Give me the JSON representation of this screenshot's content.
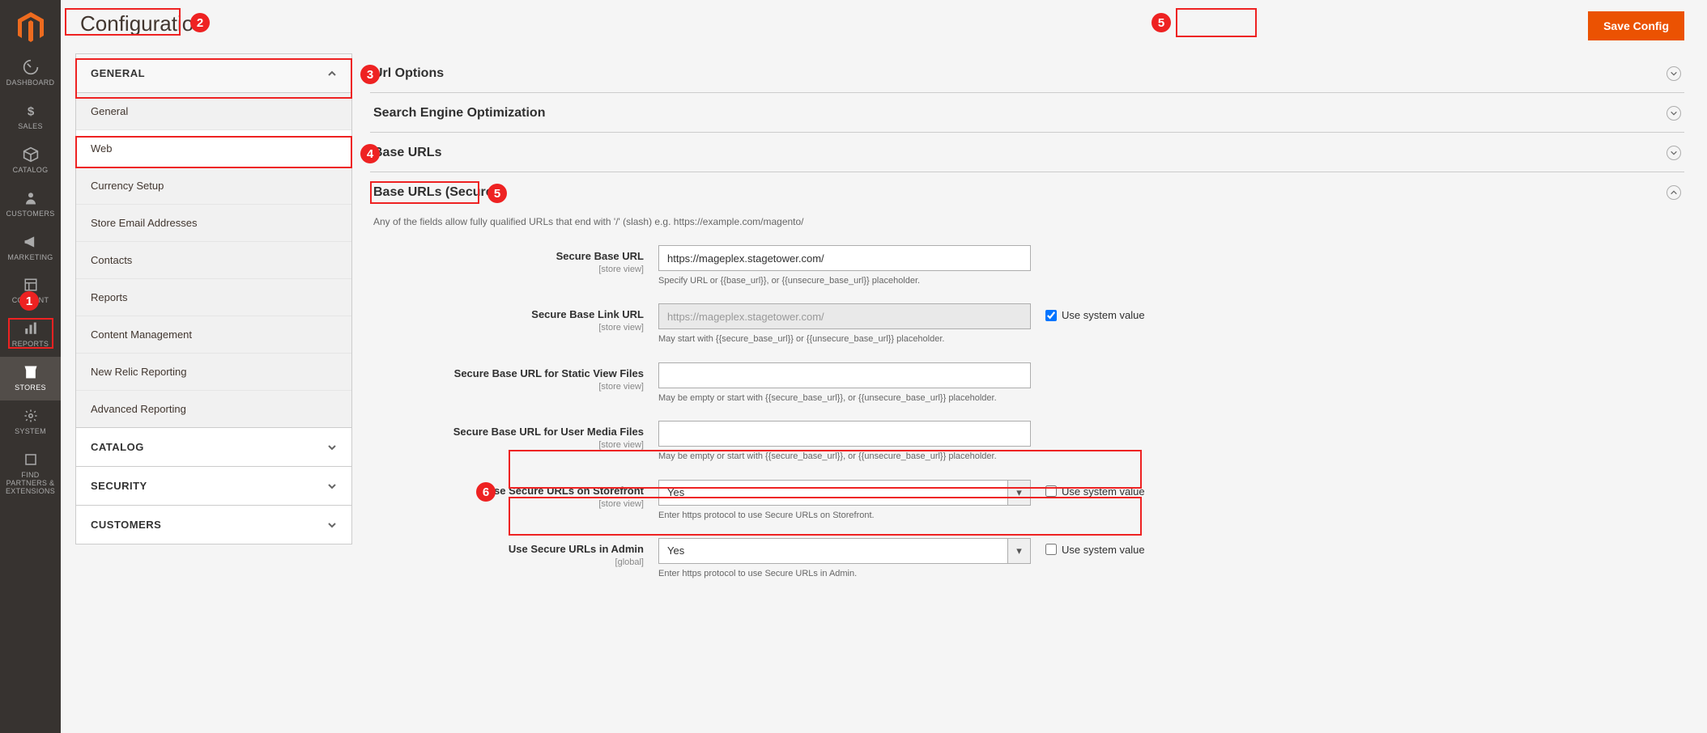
{
  "page_title": "Configuration",
  "save_button": "Save Config",
  "nav": [
    {
      "id": "dashboard",
      "label": "DASHBOARD"
    },
    {
      "id": "sales",
      "label": "SALES"
    },
    {
      "id": "catalog",
      "label": "CATALOG"
    },
    {
      "id": "customers",
      "label": "CUSTOMERS"
    },
    {
      "id": "marketing",
      "label": "MARKETING"
    },
    {
      "id": "content",
      "label": "CONTENT"
    },
    {
      "id": "reports",
      "label": "REPORTS"
    },
    {
      "id": "stores",
      "label": "STORES"
    },
    {
      "id": "system",
      "label": "SYSTEM"
    },
    {
      "id": "partners",
      "label": "FIND PARTNERS & EXTENSIONS"
    }
  ],
  "tab_groups": {
    "general": {
      "label": "GENERAL",
      "items": [
        "General",
        "Web",
        "Currency Setup",
        "Store Email Addresses",
        "Contacts",
        "Reports",
        "Content Management",
        "New Relic Reporting",
        "Advanced Reporting"
      ]
    },
    "catalog": {
      "label": "CATALOG"
    },
    "security": {
      "label": "SECURITY"
    },
    "customers": {
      "label": "CUSTOMERS"
    }
  },
  "sections": {
    "url_options": "Url Options",
    "seo": "Search Engine Optimization",
    "base_urls": "Base URLs",
    "base_urls_secure": {
      "title": "Base URLs (Secure)",
      "note": "Any of the fields allow fully qualified URLs that end with '/' (slash) e.g. https://example.com/magento/",
      "fields": {
        "secure_base_url": {
          "label": "Secure Base URL",
          "scope": "[store view]",
          "value": "https://mageplex.stagetower.com/",
          "hint": "Specify URL or {{base_url}}, or {{unsecure_base_url}} placeholder."
        },
        "secure_base_link_url": {
          "label": "Secure Base Link URL",
          "scope": "[store view]",
          "value": "https://mageplex.stagetower.com/",
          "hint": "May start with {{secure_base_url}} or {{unsecure_base_url}} placeholder.",
          "use_system": true,
          "sys_label": "Use system value"
        },
        "secure_static": {
          "label": "Secure Base URL for Static View Files",
          "scope": "[store view]",
          "value": "",
          "hint": "May be empty or start with {{secure_base_url}}, or {{unsecure_base_url}} placeholder."
        },
        "secure_media": {
          "label": "Secure Base URL for User Media Files",
          "scope": "[store view]",
          "value": "",
          "hint": "May be empty or start with {{secure_base_url}}, or {{unsecure_base_url}} placeholder."
        },
        "secure_storefront": {
          "label": "Use Secure URLs on Storefront",
          "scope": "[store view]",
          "value": "Yes",
          "hint": "Enter https protocol to use Secure URLs on Storefront.",
          "use_system": false,
          "sys_label": "Use system value"
        },
        "secure_admin": {
          "label": "Use Secure URLs in Admin",
          "scope": "[global]",
          "value": "Yes",
          "hint": "Enter https protocol to use Secure URLs in Admin.",
          "use_system": false,
          "sys_label": "Use system value"
        }
      }
    }
  }
}
